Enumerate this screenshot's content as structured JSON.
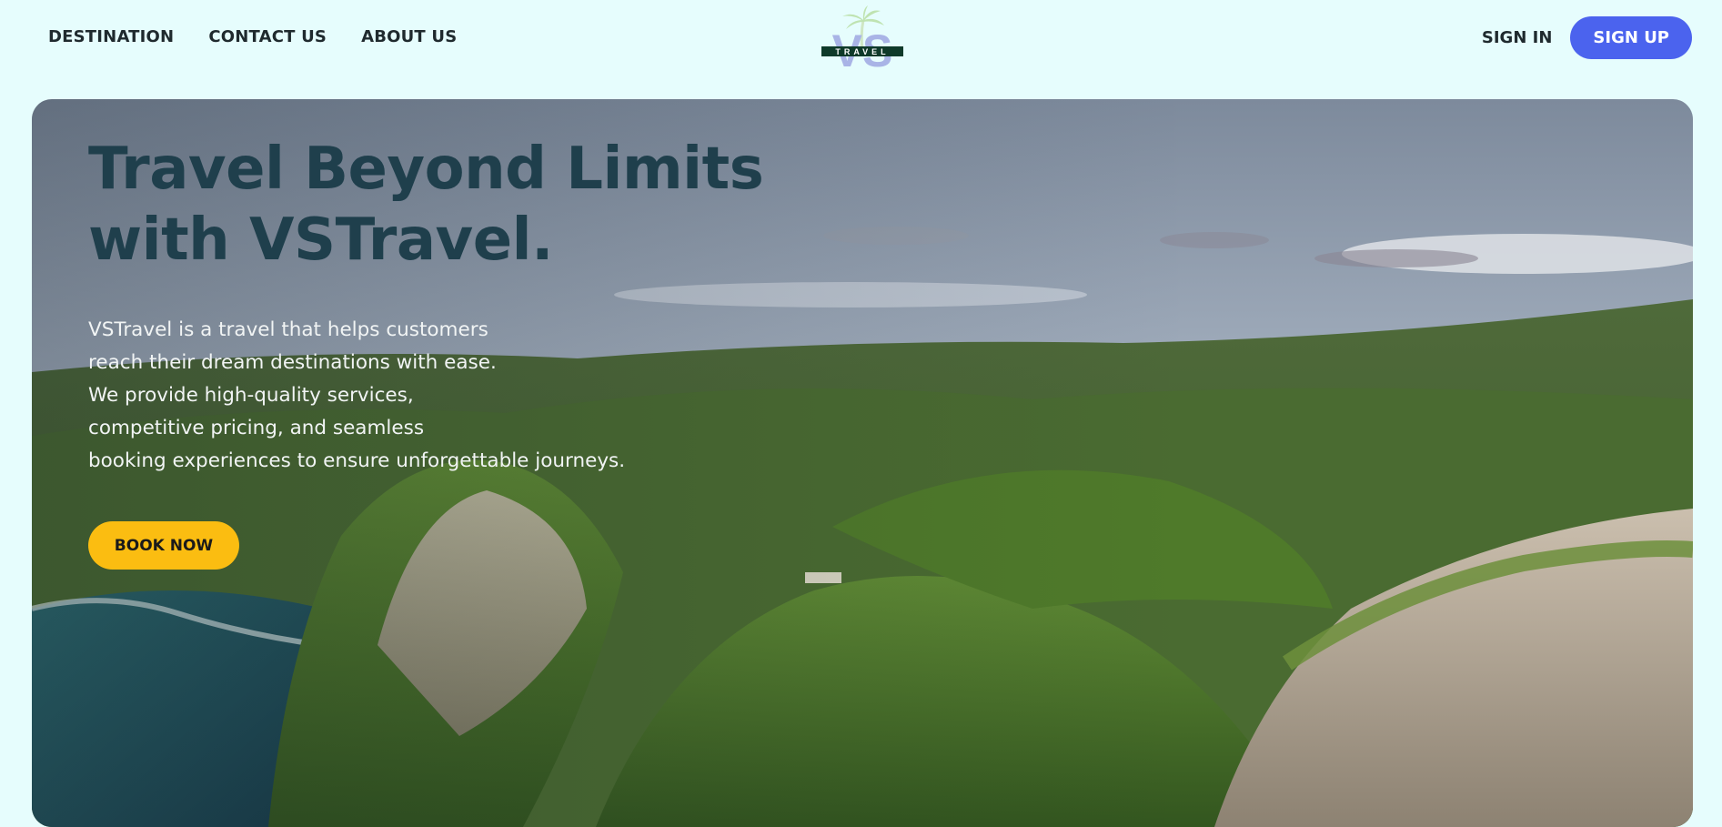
{
  "nav": {
    "links": [
      "DESTINATION",
      "CONTACT US",
      "ABOUT US"
    ],
    "sign_in": "SIGN IN",
    "sign_up": "SIGN UP"
  },
  "logo": {
    "monogram": "VS",
    "word": "TRAVEL"
  },
  "hero": {
    "title": "Travel Beyond Limits with VSTravel.",
    "description": "VSTravel is a travel that helps customers\nreach their dream destinations with ease.\nWe provide high-quality services,\ncompetitive pricing, and seamless\nbooking experiences to ensure unforgettable journeys.",
    "cta": "BOOK NOW"
  },
  "colors": {
    "page_bg": "#e6fdfd",
    "accent_blue": "#4b63ee",
    "cta_yellow": "#fbbd11",
    "title_teal": "#1f3f4c",
    "logo_green": "#0f3a2a",
    "logo_lavender": "#a9b4e6"
  }
}
